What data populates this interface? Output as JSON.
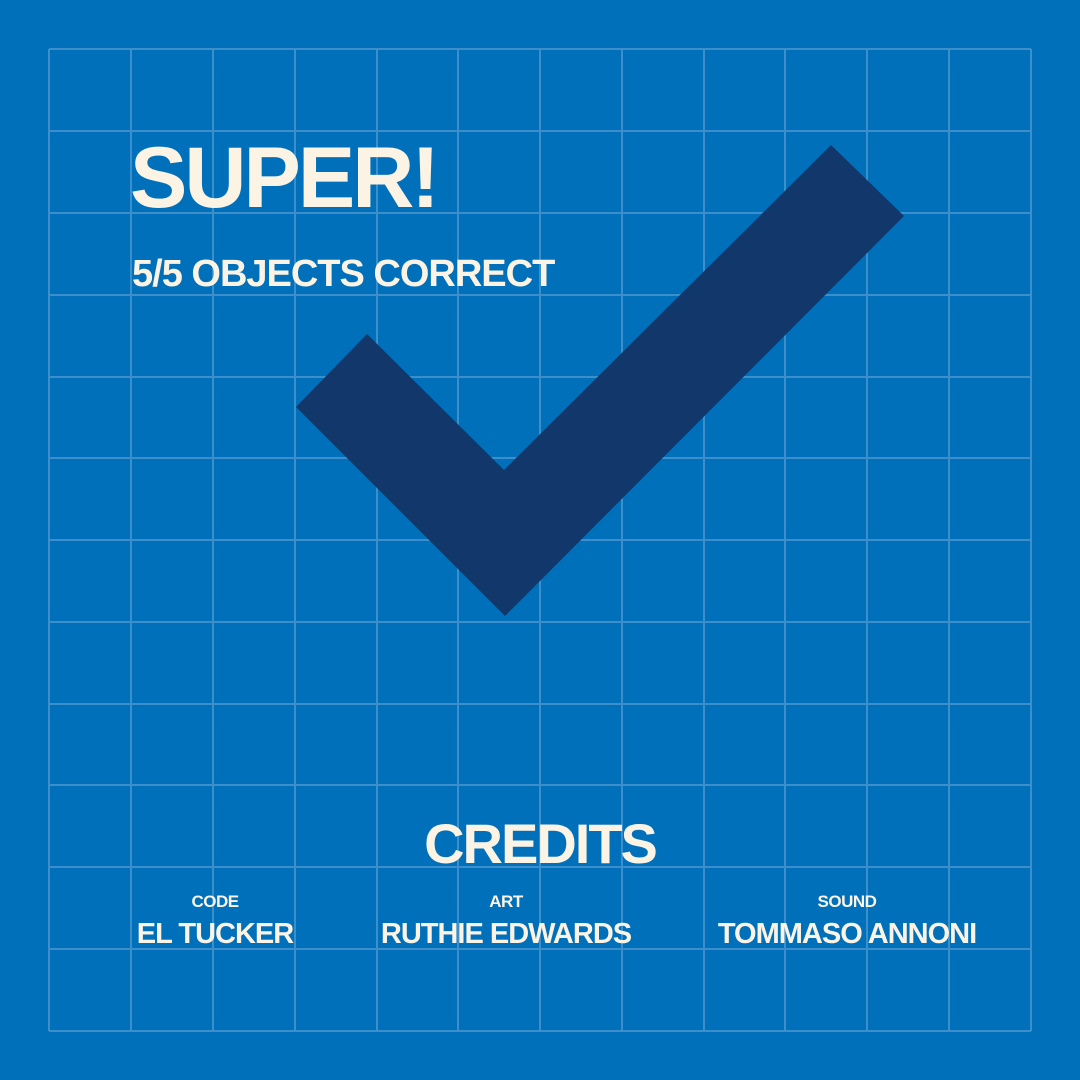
{
  "colors": {
    "background": "#0070bb",
    "grid_line": "#3d8fcc",
    "checkmark": "#12376a",
    "text": "#fbf3e4"
  },
  "result": {
    "title": "SUPER!",
    "score_text": "5/5 OBJECTS CORRECT",
    "icon": "checkmark-icon"
  },
  "credits": {
    "heading": "CREDITS",
    "entries": [
      {
        "role": "CODE",
        "name": "EL TUCKER"
      },
      {
        "role": "ART",
        "name": "RUTHIE EDWARDS"
      },
      {
        "role": "SOUND",
        "name": "TOMMASO ANNONI"
      }
    ]
  }
}
